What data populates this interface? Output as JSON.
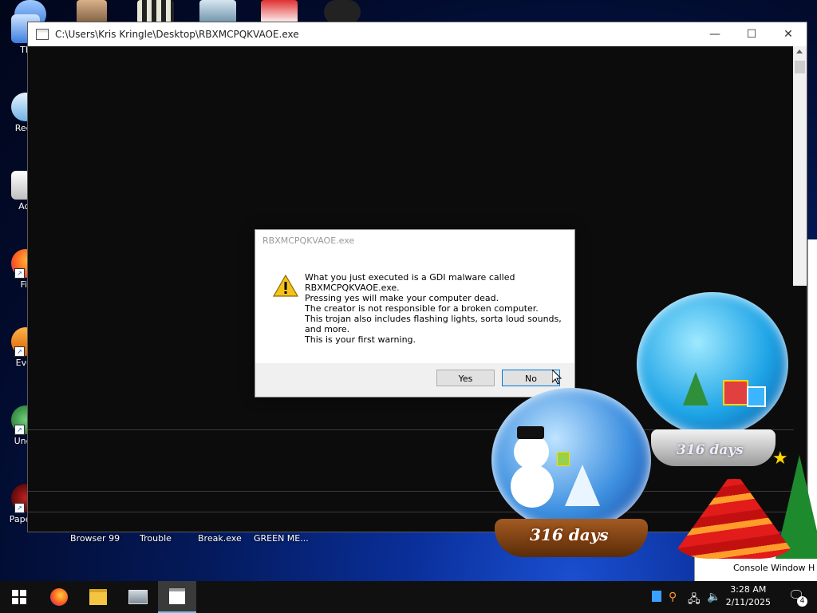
{
  "desktop": {
    "icons": [
      {
        "label": "Th"
      },
      {
        "label": "Recy"
      },
      {
        "label": "Act"
      },
      {
        "label": "Fir"
      },
      {
        "label": "Ever"
      },
      {
        "label": "Unde"
      },
      {
        "label": "Papers,"
      }
    ]
  },
  "console": {
    "title": "C:\\Users\\Kris Kringle\\Desktop\\RBXMCPQKVAOE.exe",
    "minimize": "—",
    "maximize": "☐",
    "close": "✕"
  },
  "dialog": {
    "title": "RBXMCPQKVAOE.exe",
    "lines": [
      "What you just executed is a GDI malware called",
      "RBXMCPQKVAOE.exe.",
      "Pressing yes will make your computer dead.",
      "The creator is not responsible for a broken computer.",
      "This trojan also includes flashing lights, sorta loud sounds,",
      "and more.",
      "This is your first warning."
    ],
    "yes": "Yes",
    "no": "No"
  },
  "bottom_labels": [
    "Browser 99",
    "Trouble",
    "Break.exe",
    "GREEN ME..."
  ],
  "globes": {
    "left_days": "316 days",
    "right_days": "316 days"
  },
  "right_fragments": [
    "Console Window H"
  ],
  "taskbar": {
    "time": "3:28 AM",
    "date": "2/11/2025",
    "notification_count": "4",
    "icons": [
      "start-icon",
      "firefox-icon",
      "file-explorer-icon",
      "control-panel-icon",
      "console-icon"
    ]
  }
}
